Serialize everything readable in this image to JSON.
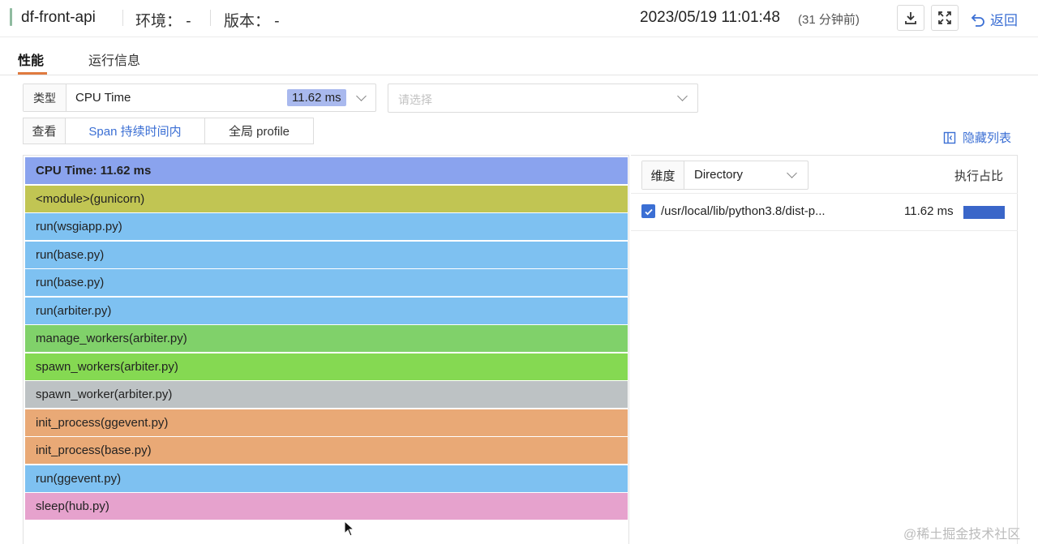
{
  "header": {
    "app_name": "df-front-api",
    "env": "环境： -",
    "version": "版本： -",
    "datetime": "2023/05/19 11:01:48",
    "ago": "(31 分钟前)",
    "back_label": "返回",
    "icons": [
      "download-icon",
      "fullscreen-icon",
      "back-icon"
    ]
  },
  "tabs": [
    {
      "label": "性能",
      "active": true
    },
    {
      "label": "运行信息",
      "active": false
    }
  ],
  "filter": {
    "type_label": "类型",
    "type_value": "CPU Time",
    "type_badge": "11.62 ms",
    "second_placeholder": "请选择",
    "view_label": "查看",
    "view_options": [
      {
        "label": "Span 持续时间内",
        "active": true
      },
      {
        "label": "全局 profile",
        "active": false
      }
    ],
    "hide_list": "隐藏列表"
  },
  "flame": {
    "frames": [
      {
        "label": "CPU Time: 11.62 ms",
        "color": "#8aa3ee"
      },
      {
        "label": "<module>(gunicorn)",
        "color": "#c1c553"
      },
      {
        "label": "run(wsgiapp.py)",
        "color": "#7ec1f1"
      },
      {
        "label": "run(base.py)",
        "color": "#7ec1f1"
      },
      {
        "label": "run(base.py)",
        "color": "#7ec1f1"
      },
      {
        "label": "run(arbiter.py)",
        "color": "#7ec1f1"
      },
      {
        "label": "manage_workers(arbiter.py)",
        "color": "#80d16a"
      },
      {
        "label": "spawn_workers(arbiter.py)",
        "color": "#85d952"
      },
      {
        "label": "spawn_worker(arbiter.py)",
        "color": "#bdc2c4"
      },
      {
        "label": "init_process(ggevent.py)",
        "color": "#e9a976"
      },
      {
        "label": "init_process(base.py)",
        "color": "#e9a976"
      },
      {
        "label": "run(ggevent.py)",
        "color": "#7ec1f1"
      },
      {
        "label": "sleep(hub.py)",
        "color": "#e6a2cd"
      }
    ]
  },
  "panel": {
    "dim_label": "维度",
    "dim_value": "Directory",
    "ratio_header": "执行占比",
    "rows": [
      {
        "path": "/usr/local/lib/python3.8/dist-p...",
        "value": "11.62 ms",
        "ratio": 1.0,
        "checked": true
      }
    ]
  },
  "watermark": "@稀土掘金技术社区"
}
